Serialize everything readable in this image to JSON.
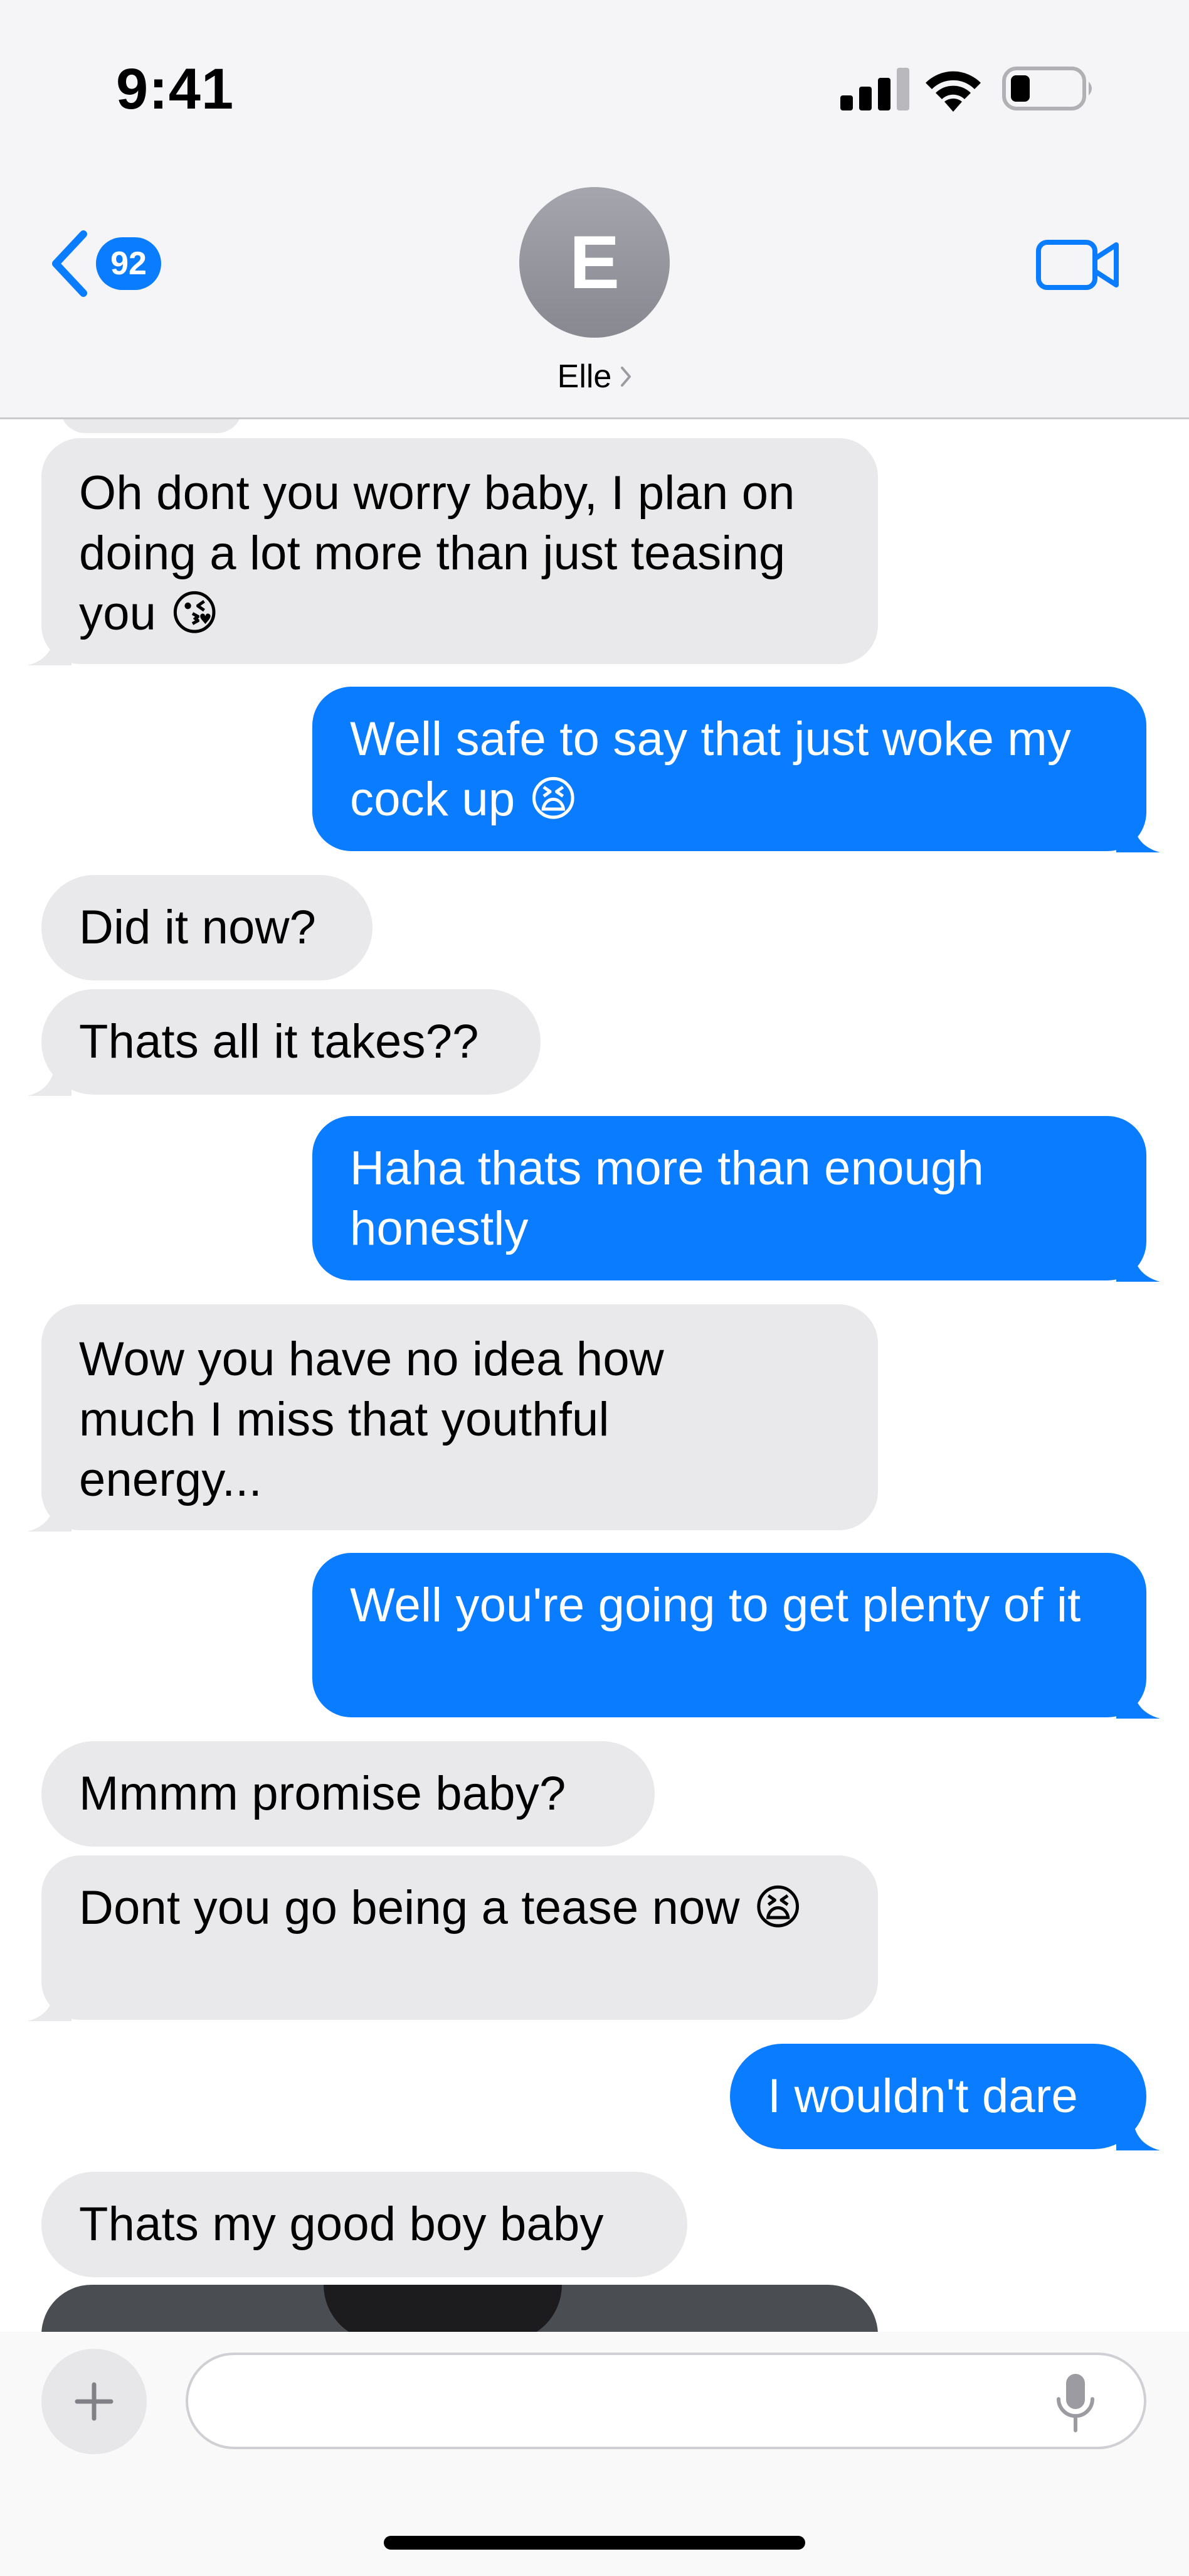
{
  "status_bar": {
    "time": "9:41"
  },
  "header": {
    "back_badge": "92",
    "avatar_initial": "E",
    "contact_name": "Elle"
  },
  "colors": {
    "outgoing": "#0a7cff",
    "incoming": "#e9e9eb",
    "header_bg": "#f5f5f7"
  },
  "messages": [
    {
      "from": "them",
      "text": "Oh dont you worry baby, I plan on doing a lot more than just teasing you 😘"
    },
    {
      "from": "me",
      "text": "Well safe to say that just woke my cock up 😫"
    },
    {
      "from": "them",
      "text": "Did it now?"
    },
    {
      "from": "them",
      "text": "Thats all it takes??"
    },
    {
      "from": "me",
      "text": "Haha thats more than enough honestly"
    },
    {
      "from": "them",
      "text": "Wow you have no idea how much I miss that youthful energy..."
    },
    {
      "from": "me",
      "text": "Well you're going to get plenty of it"
    },
    {
      "from": "them",
      "text": "Mmmm promise baby?"
    },
    {
      "from": "them",
      "text": "Dont you go being a tease now 😫"
    },
    {
      "from": "me",
      "text": "I wouldn't dare"
    },
    {
      "from": "them",
      "text": "Thats my good boy baby"
    }
  ],
  "composer": {
    "placeholder": ""
  },
  "icons": {
    "back": "chevron-left-icon",
    "video": "video-camera-icon",
    "add": "plus-icon",
    "mic": "microphone-icon"
  }
}
